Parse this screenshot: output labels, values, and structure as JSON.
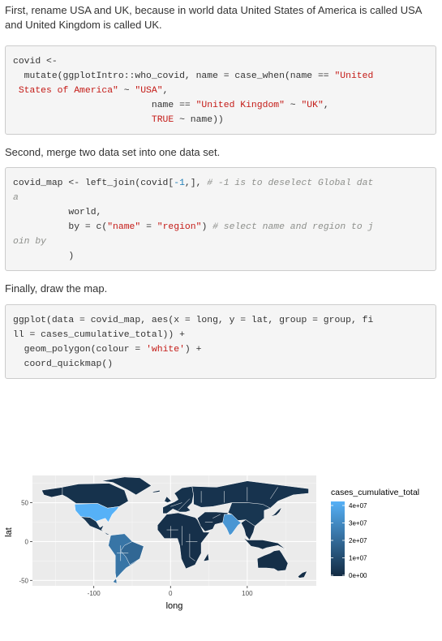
{
  "paragraphs": [
    "First, rename USA and UK, because in world data United States of America is called USA and United Kingdom is called UK.",
    "Second, merge two data set into one data set.",
    "Finally, draw the map."
  ],
  "code_blocks": [
    [
      [
        [
          "plain",
          "covid <-"
        ]
      ],
      [
        [
          "plain",
          "  mutate(ggplotIntro::who_covid, name = case_when(name == "
        ],
        [
          "str",
          "\"United"
        ]
      ],
      [
        [
          "str",
          " States of America\""
        ],
        [
          "plain",
          " ~ "
        ],
        [
          "str",
          "\"USA\""
        ],
        [
          "plain",
          ","
        ]
      ],
      [
        [
          "plain",
          "                         name == "
        ],
        [
          "str",
          "\"United Kingdom\""
        ],
        [
          "plain",
          " ~ "
        ],
        [
          "str",
          "\"UK\""
        ],
        [
          "plain",
          ","
        ]
      ],
      [
        [
          "plain",
          "                         "
        ],
        [
          "kw",
          "TRUE"
        ],
        [
          "plain",
          " ~ name))"
        ]
      ]
    ],
    [
      [
        [
          "plain",
          "covid_map <- left_join(covid["
        ],
        [
          "num",
          "-1"
        ],
        [
          "plain",
          ",], "
        ],
        [
          "com",
          "# -1 is to deselect Global dat"
        ]
      ],
      [
        [
          "com",
          "a"
        ]
      ],
      [
        [
          "plain",
          "          world,"
        ]
      ],
      [
        [
          "plain",
          "          by = c("
        ],
        [
          "str",
          "\"name\""
        ],
        [
          "plain",
          " = "
        ],
        [
          "str",
          "\"region\""
        ],
        [
          "plain",
          ") "
        ],
        [
          "com",
          "# select name and region to j"
        ]
      ],
      [
        [
          "com",
          "oin by"
        ]
      ],
      [
        [
          "plain",
          "          )"
        ]
      ]
    ],
    [
      [
        [
          "plain",
          "ggplot(data = covid_map, aes(x = long, y = lat, group = group, fi"
        ]
      ],
      [
        [
          "plain",
          "ll = cases_cumulative_total)) +"
        ]
      ],
      [
        [
          "plain",
          "  geom_polygon(colour = "
        ],
        [
          "str",
          "'white'"
        ],
        [
          "plain",
          ") +"
        ]
      ],
      [
        [
          "plain",
          "  coord_quickmap()"
        ]
      ]
    ]
  ],
  "chart_data": {
    "type": "map",
    "xlabel": "long",
    "ylabel": "lat",
    "xlim": [
      -180,
      190
    ],
    "ylim": [
      -57,
      85
    ],
    "x_ticks": [
      -100,
      0,
      100
    ],
    "y_ticks": [
      -50,
      0,
      50
    ],
    "grid": true,
    "legend_position": "right",
    "legend": {
      "title": "cases_cumulative_total",
      "labels": [
        "4e+07",
        "3e+07",
        "2e+07",
        "1e+07",
        "0e+00"
      ],
      "values": [
        40000000,
        30000000,
        20000000,
        10000000,
        0
      ],
      "color_low": "#132b43",
      "color_high": "#56b1f7"
    },
    "panel_bg": "#ebebeb",
    "border_color": "#ffffff"
  }
}
